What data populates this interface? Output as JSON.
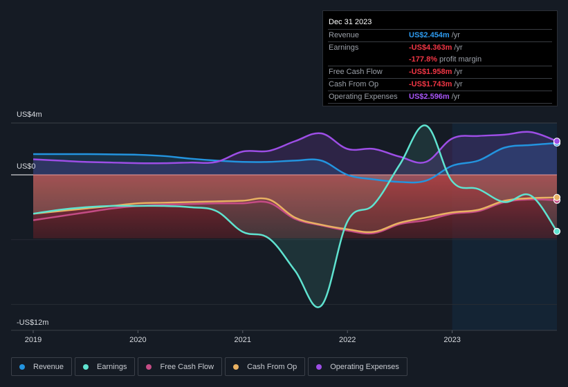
{
  "tooltip": {
    "date": "Dec 31 2023",
    "rows": [
      {
        "label": "Revenue",
        "value": "US$2.454m",
        "unit": "/yr",
        "color": "#2d9bf0"
      },
      {
        "label": "Earnings",
        "value": "-US$4.363m",
        "unit": "/yr",
        "color": "#f23645"
      },
      {
        "label": "",
        "value": "-177.8%",
        "unit": "profit margin",
        "color": "#f23645"
      },
      {
        "label": "Free Cash Flow",
        "value": "-US$1.958m",
        "unit": "/yr",
        "color": "#f23645"
      },
      {
        "label": "Cash From Op",
        "value": "-US$1.743m",
        "unit": "/yr",
        "color": "#f23645"
      },
      {
        "label": "Operating Expenses",
        "value": "US$2.596m",
        "unit": "/yr",
        "color": "#a855f7"
      }
    ]
  },
  "legend": [
    {
      "label": "Revenue",
      "color": "#2394df"
    },
    {
      "label": "Earnings",
      "color": "#5fe3d0"
    },
    {
      "label": "Free Cash Flow",
      "color": "#c44c85"
    },
    {
      "label": "Cash From Op",
      "color": "#e9b162"
    },
    {
      "label": "Operating Expenses",
      "color": "#9d4ee6"
    }
  ],
  "chart_data": {
    "type": "line",
    "title": "",
    "xlabel": "",
    "ylabel": "",
    "y_tick_labels": [
      "US$4m",
      "US$0",
      "-US$12m"
    ],
    "x_tick_labels": [
      "2019",
      "2020",
      "2021",
      "2022",
      "2023"
    ],
    "ylim": [
      -12,
      4
    ],
    "xlim": [
      2019,
      2024
    ],
    "grid": true,
    "highlight_region": {
      "from": 2023,
      "to": 2024
    },
    "legend_position": "bottom",
    "x": [
      2019,
      2019.25,
      2019.5,
      2019.75,
      2020,
      2020.25,
      2020.5,
      2020.75,
      2021,
      2021.25,
      2021.5,
      2021.75,
      2022,
      2022.25,
      2022.5,
      2022.75,
      2023,
      2023.25,
      2023.5,
      2023.75,
      2024
    ],
    "series": [
      {
        "name": "Revenue",
        "color": "#2394df",
        "values": [
          1.6,
          1.6,
          1.6,
          1.58,
          1.55,
          1.45,
          1.25,
          1.1,
          1.0,
          1.0,
          1.1,
          1.1,
          0.0,
          -0.35,
          -0.55,
          -0.45,
          0.7,
          1.1,
          2.1,
          2.3,
          2.454
        ]
      },
      {
        "name": "Earnings",
        "color": "#5fe3d0",
        "values": [
          -3.0,
          -2.7,
          -2.5,
          -2.4,
          -2.4,
          -2.4,
          -2.5,
          -2.8,
          -4.4,
          -4.9,
          -7.4,
          -10.1,
          -3.6,
          -2.3,
          0.8,
          3.8,
          -0.5,
          -1.1,
          -2.1,
          -1.6,
          -4.363
        ]
      },
      {
        "name": "Free Cash Flow",
        "color": "#c44c85",
        "values": [
          -3.5,
          -3.2,
          -2.9,
          -2.6,
          -2.4,
          -2.3,
          -2.25,
          -2.2,
          -2.2,
          -2.15,
          -3.4,
          -3.9,
          -4.3,
          -4.5,
          -3.8,
          -3.5,
          -3.0,
          -2.8,
          -2.1,
          -1.9,
          -1.958
        ]
      },
      {
        "name": "Cash From Op",
        "color": "#e9b162",
        "values": [
          -3.0,
          -2.8,
          -2.6,
          -2.4,
          -2.2,
          -2.15,
          -2.1,
          -2.05,
          -2.0,
          -1.9,
          -3.3,
          -3.85,
          -4.2,
          -4.4,
          -3.7,
          -3.3,
          -2.9,
          -2.7,
          -2.0,
          -1.8,
          -1.743
        ]
      },
      {
        "name": "Operating Expenses",
        "color": "#9d4ee6",
        "values": [
          1.2,
          1.1,
          1.0,
          0.95,
          0.9,
          0.9,
          0.95,
          1.0,
          1.8,
          1.85,
          2.6,
          3.2,
          2.0,
          2.0,
          1.4,
          1.0,
          2.8,
          3.0,
          3.1,
          3.3,
          2.596
        ]
      }
    ]
  }
}
